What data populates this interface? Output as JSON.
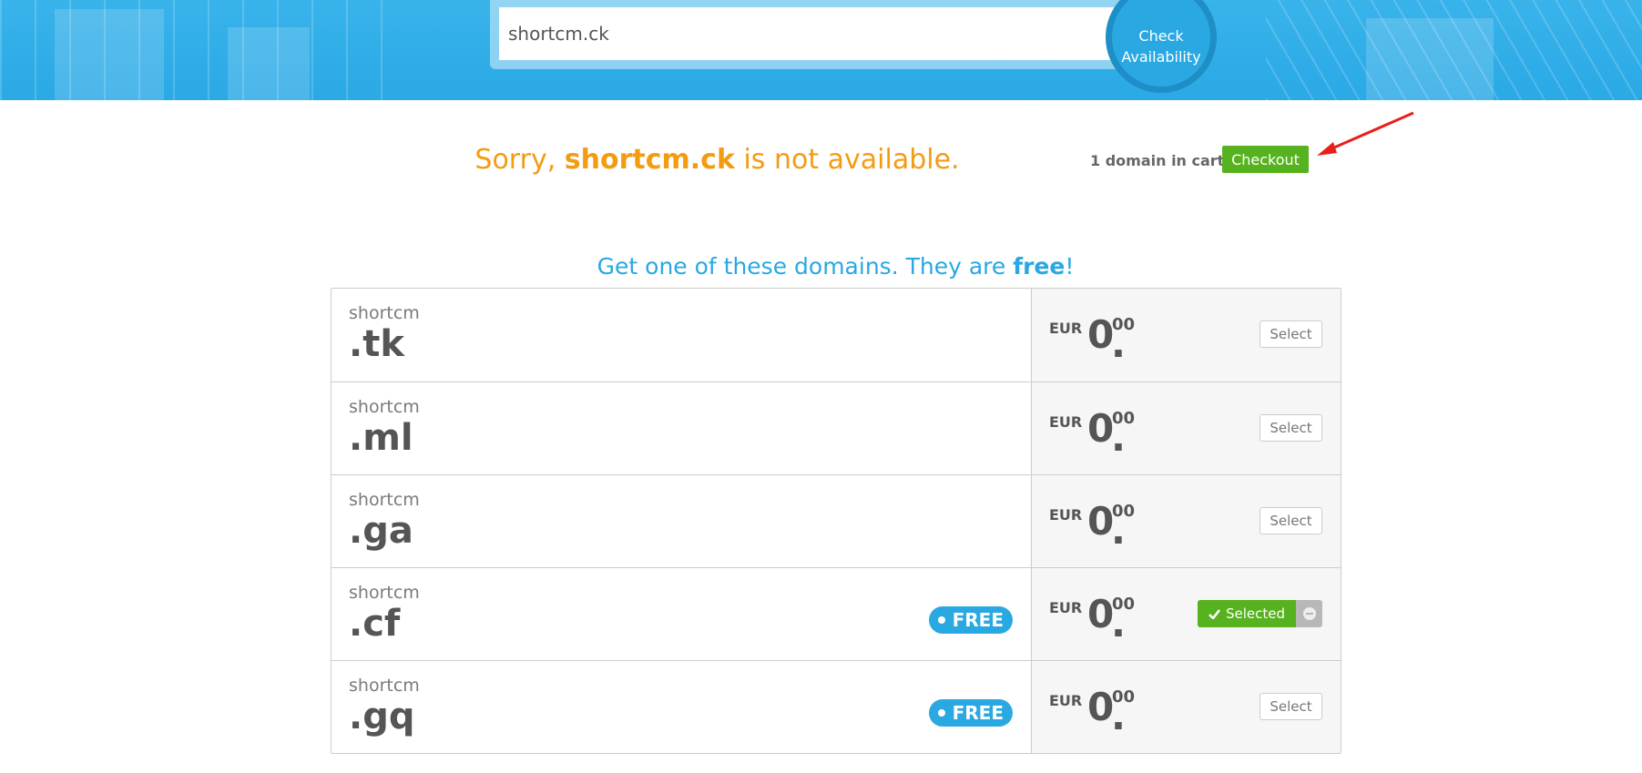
{
  "search": {
    "value": "shortcm.ck",
    "button_line1": "Check",
    "button_line2": "Availability"
  },
  "status": {
    "prefix": "Sorry, ",
    "domain": "shortcm.ck",
    "suffix": " is not available.",
    "cart_text": "1 domain in cart",
    "checkout_label": "Checkout"
  },
  "offers": {
    "heading_prefix": "Get one of these domains. They are ",
    "heading_bold": "free",
    "heading_suffix": "!",
    "rows": [
      {
        "base": "shortcm",
        "tld": ".tk",
        "currency": "EUR",
        "amount": "0",
        "cents": "00",
        "action": "Select",
        "badge": ""
      },
      {
        "base": "shortcm",
        "tld": ".ml",
        "currency": "EUR",
        "amount": "0",
        "cents": "00",
        "action": "Select",
        "badge": ""
      },
      {
        "base": "shortcm",
        "tld": ".ga",
        "currency": "EUR",
        "amount": "0",
        "cents": "00",
        "action": "Select",
        "badge": ""
      },
      {
        "base": "shortcm",
        "tld": ".cf",
        "currency": "EUR",
        "amount": "0",
        "cents": "00",
        "action": "Selected",
        "badge": "FREE"
      },
      {
        "base": "shortcm",
        "tld": ".gq",
        "currency": "EUR",
        "amount": "0",
        "cents": "00",
        "action": "Select",
        "badge": "FREE"
      }
    ]
  },
  "colors": {
    "brand_blue": "#29a8e2",
    "warning_orange": "#f39c12",
    "success_green": "#56b21e",
    "annotation_red": "#e8201c"
  }
}
